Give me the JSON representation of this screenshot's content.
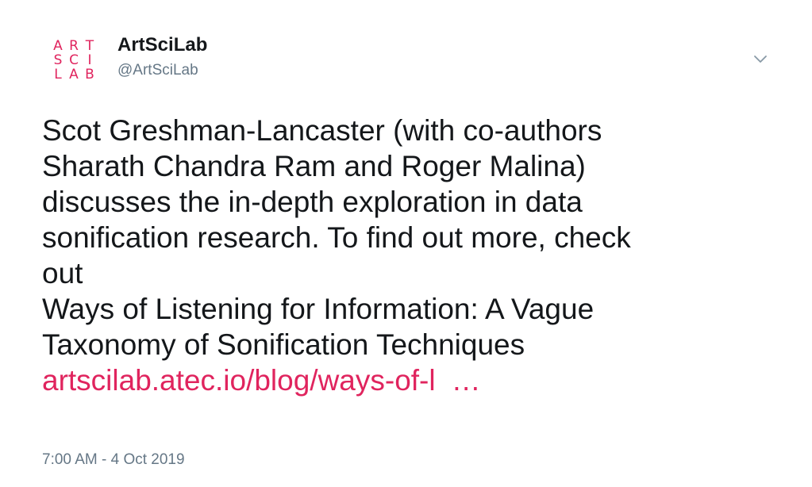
{
  "tweet": {
    "avatar": {
      "letters": [
        "A",
        "R",
        "T",
        "S",
        "C",
        "I",
        "L",
        "A",
        "B"
      ],
      "color": "#e0245e"
    },
    "display_name": "ArtSciLab",
    "handle": "@ArtSciLab",
    "menu_icon": "chevron-down-icon",
    "text_lines": [
      "Scot Greshman-Lancaster (with co-authors",
      "Sharath Chandra Ram and Roger Malina)",
      "discusses the in-depth exploration in data",
      "sonification research. To find out more, check",
      "out",
      "Ways of Listening for Information: A Vague",
      "Taxonomy of Sonification Techniques"
    ],
    "link": {
      "text": "artscilab.atec.io/blog/ways-of-l",
      "ellipsis": "…",
      "color": "#e0245e"
    },
    "timestamp": "7:00 AM - 4 Oct 2019"
  }
}
